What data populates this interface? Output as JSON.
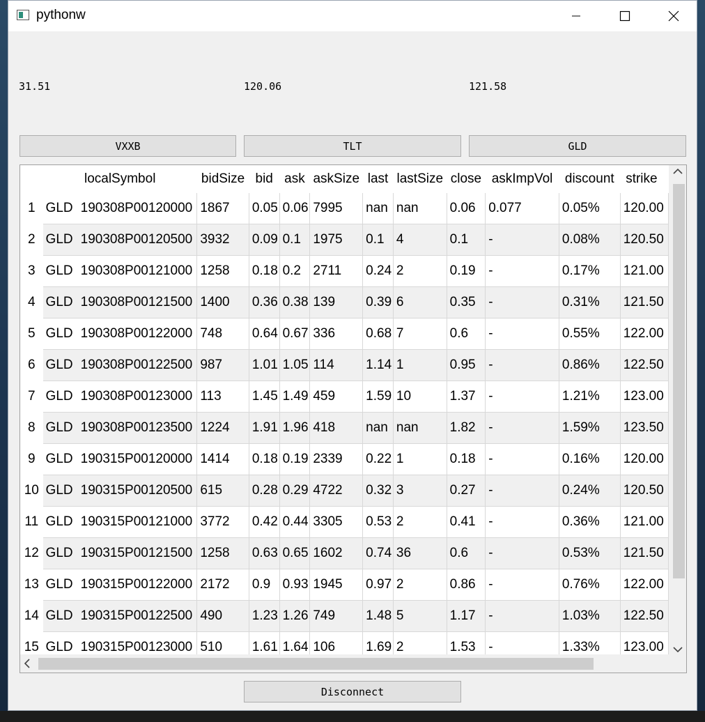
{
  "window": {
    "title": "pythonw"
  },
  "prices": [
    "31.51",
    "120.06",
    "121.58"
  ],
  "buttons": {
    "vxxb": "VXXB",
    "tlt": "TLT",
    "gld": "GLD",
    "disconnect": "Disconnect"
  },
  "table": {
    "columns": [
      "",
      "localSymbol",
      "bidSize",
      "bid",
      "ask",
      "askSize",
      "last",
      "lastSize",
      "close",
      "askImpVol",
      "discount",
      "strike"
    ],
    "rows": [
      [
        "1",
        "GLD",
        "190308P00120000",
        "1867",
        "0.05",
        "0.06",
        "7995",
        "nan",
        "nan",
        "0.06",
        "0.077",
        "0.05%",
        "120.00"
      ],
      [
        "2",
        "GLD",
        "190308P00120500",
        "3932",
        "0.09",
        "0.1",
        "1975",
        "0.1",
        "4",
        "0.1",
        "-",
        "0.08%",
        "120.50"
      ],
      [
        "3",
        "GLD",
        "190308P00121000",
        "1258",
        "0.18",
        "0.2",
        "2711",
        "0.24",
        "2",
        "0.19",
        "-",
        "0.17%",
        "121.00"
      ],
      [
        "4",
        "GLD",
        "190308P00121500",
        "1400",
        "0.36",
        "0.38",
        "139",
        "0.39",
        "6",
        "0.35",
        "-",
        "0.31%",
        "121.50"
      ],
      [
        "5",
        "GLD",
        "190308P00122000",
        "748",
        "0.64",
        "0.67",
        "336",
        "0.68",
        "7",
        "0.6",
        "-",
        "0.55%",
        "122.00"
      ],
      [
        "6",
        "GLD",
        "190308P00122500",
        "987",
        "1.01",
        "1.05",
        "114",
        "1.14",
        "1",
        "0.95",
        "-",
        "0.86%",
        "122.50"
      ],
      [
        "7",
        "GLD",
        "190308P00123000",
        "113",
        "1.45",
        "1.49",
        "459",
        "1.59",
        "10",
        "1.37",
        "-",
        "1.21%",
        "123.00"
      ],
      [
        "8",
        "GLD",
        "190308P00123500",
        "1224",
        "1.91",
        "1.96",
        "418",
        "nan",
        "nan",
        "1.82",
        "-",
        "1.59%",
        "123.50"
      ],
      [
        "9",
        "GLD",
        "190315P00120000",
        "1414",
        "0.18",
        "0.19",
        "2339",
        "0.22",
        "1",
        "0.18",
        "-",
        "0.16%",
        "120.00"
      ],
      [
        "10",
        "GLD",
        "190315P00120500",
        "615",
        "0.28",
        "0.29",
        "4722",
        "0.32",
        "3",
        "0.27",
        "-",
        "0.24%",
        "120.50"
      ],
      [
        "11",
        "GLD",
        "190315P00121000",
        "3772",
        "0.42",
        "0.44",
        "3305",
        "0.53",
        "2",
        "0.41",
        "-",
        "0.36%",
        "121.00"
      ],
      [
        "12",
        "GLD",
        "190315P00121500",
        "1258",
        "0.63",
        "0.65",
        "1602",
        "0.74",
        "36",
        "0.6",
        "-",
        "0.53%",
        "121.50"
      ],
      [
        "13",
        "GLD",
        "190315P00122000",
        "2172",
        "0.9",
        "0.93",
        "1945",
        "0.97",
        "2",
        "0.86",
        "-",
        "0.76%",
        "122.00"
      ],
      [
        "14",
        "GLD",
        "190315P00122500",
        "490",
        "1.23",
        "1.26",
        "749",
        "1.48",
        "5",
        "1.17",
        "-",
        "1.03%",
        "122.50"
      ],
      [
        "15",
        "GLD",
        "190315P00123000",
        "510",
        "1.61",
        "1.64",
        "106",
        "1.69",
        "2",
        "1.53",
        "-",
        "1.33%",
        "123.00"
      ]
    ]
  }
}
